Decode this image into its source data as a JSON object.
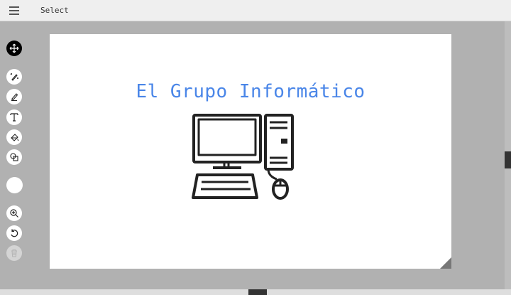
{
  "header": {
    "menu_icon": "hamburger-menu-icon",
    "mode_label": "Select"
  },
  "toolbar": {
    "tools": [
      {
        "name": "move",
        "icon": "move-arrows-icon",
        "active": true
      },
      {
        "name": "draw-magic",
        "icon": "magic-pen-icon"
      },
      {
        "name": "pen",
        "icon": "pen-icon"
      },
      {
        "name": "text",
        "icon": "text-icon"
      },
      {
        "name": "fill",
        "icon": "paint-bucket-icon"
      },
      {
        "name": "shapes",
        "icon": "shapes-icon"
      },
      {
        "name": "color",
        "icon": "color-swatch",
        "value": "#ffffff"
      },
      {
        "name": "zoom",
        "icon": "zoom-in-icon"
      },
      {
        "name": "undo",
        "icon": "undo-icon"
      },
      {
        "name": "delete",
        "icon": "trash-icon",
        "disabled": true
      }
    ]
  },
  "canvas": {
    "title": "El Grupo Informático",
    "title_color": "#4a86e8",
    "image": "desktop-computer-icon"
  }
}
